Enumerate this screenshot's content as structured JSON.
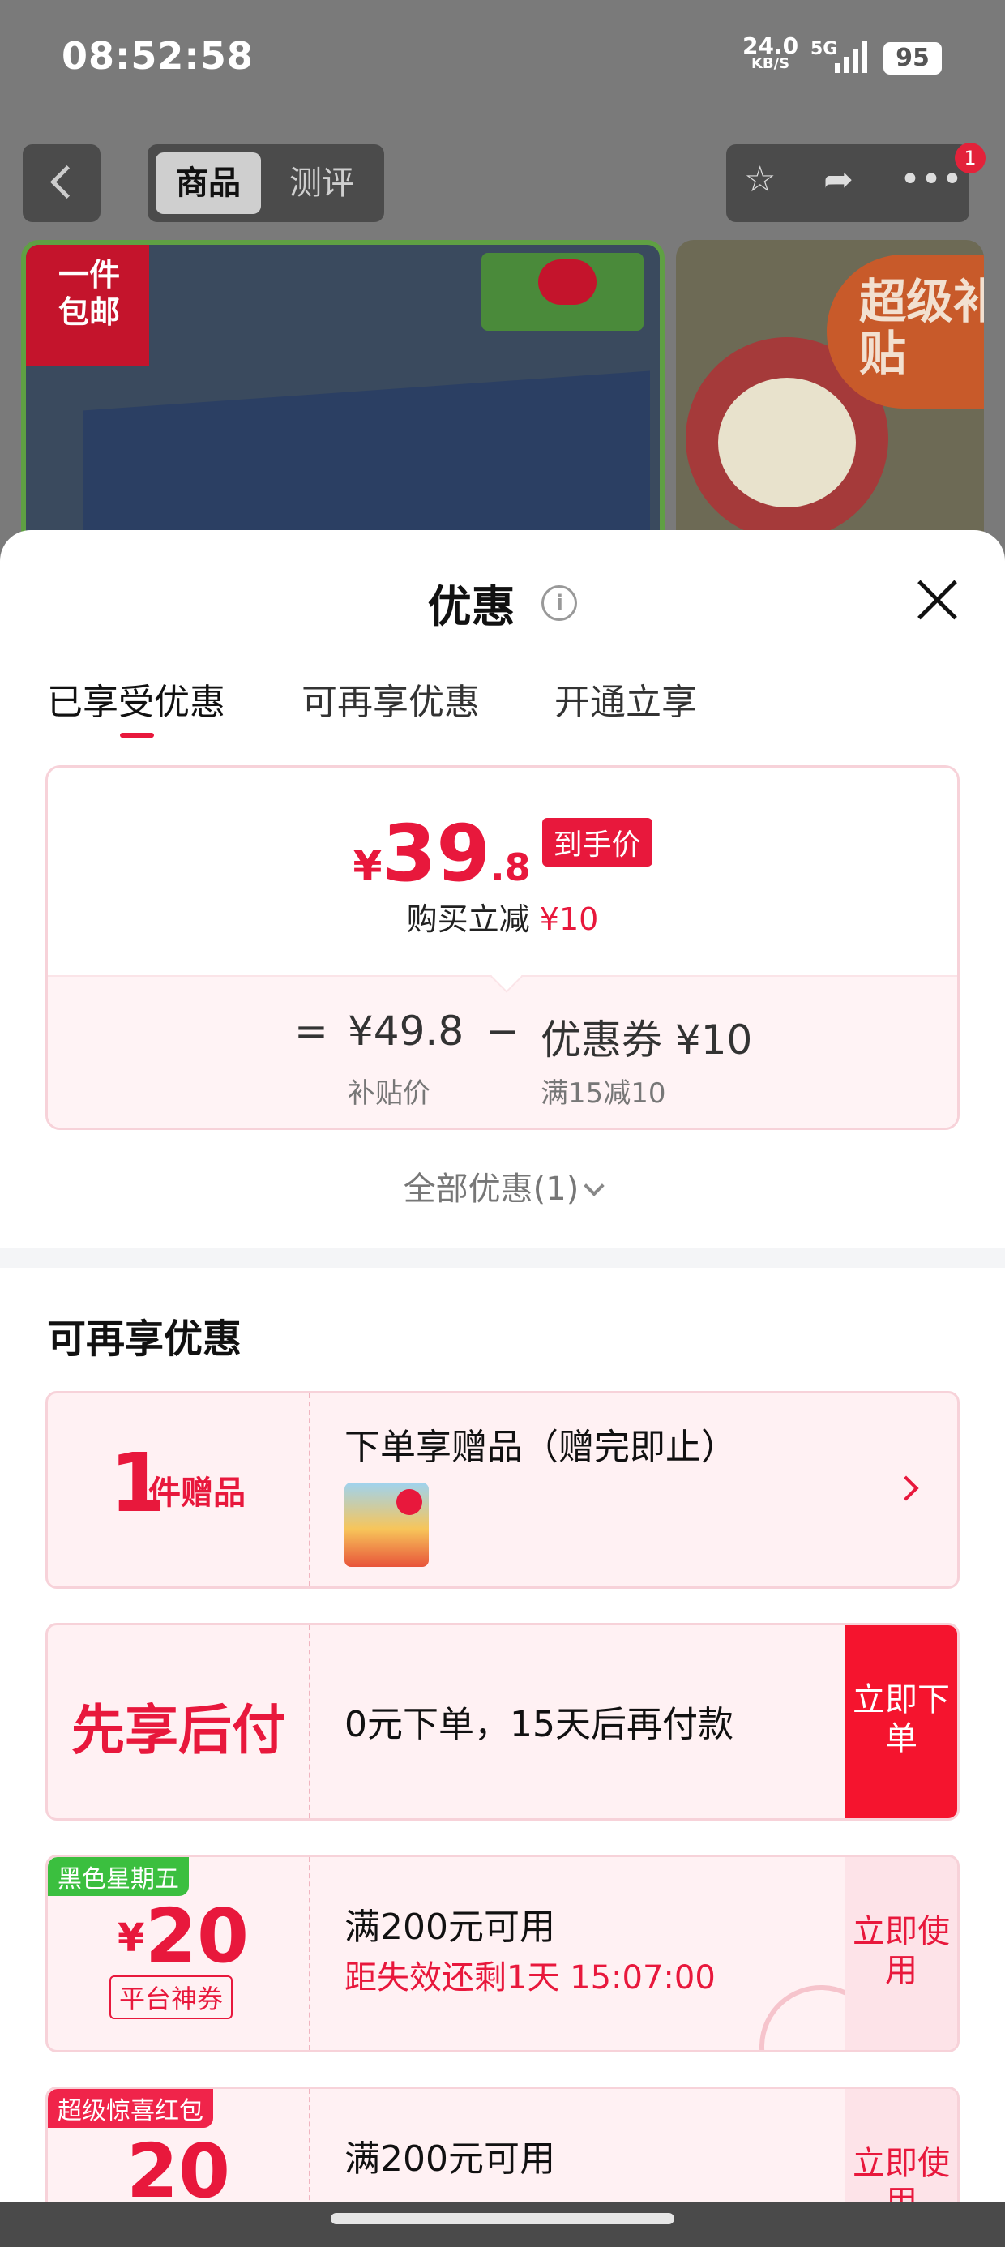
{
  "status_bar": {
    "time": "08:52:58",
    "net_speed": "24.0",
    "net_unit": "KB/S",
    "signal": "5G",
    "battery": "95"
  },
  "nav": {
    "tabs": [
      "商品",
      "测评"
    ],
    "badge_count": "1"
  },
  "product_banner": {
    "ribbon_text": "一件包邮",
    "super_tag": "超级补贴"
  },
  "sheet": {
    "title": "优惠",
    "close_icon": "close-icon",
    "tabs": [
      "已享受优惠",
      "可再享优惠",
      "开通立享"
    ],
    "active_tab": 0,
    "price": {
      "currency": "¥",
      "integer": "39",
      "decimal": ".8",
      "tag": "到手价",
      "subtitle_prefix": "购买立减",
      "subtitle_amount": "¥10"
    },
    "formula": {
      "equals": "=",
      "base_price": "¥49.8",
      "base_label": "补贴价",
      "minus": "−",
      "coupon_price": "优惠券 ¥10",
      "coupon_label": "满15减10"
    },
    "all_discounts": "全部优惠(1)"
  },
  "more_discounts": {
    "title": "可再享优惠",
    "items": [
      {
        "left_number": "1",
        "left_unit": "件赠品",
        "text": "下单享赠品（赠完即止）"
      },
      {
        "left_text": "先享后付",
        "text": "0元下单，15天后再付款",
        "button": "立即下单"
      },
      {
        "tag": "黑色星期五",
        "tag_color": "#3bbf3f",
        "currency": "¥",
        "amount": "20",
        "type_label": "平台神券",
        "text": "满200元可用",
        "subtext": "距失效还剩1天 15:07:00",
        "button": "立即使用"
      },
      {
        "tag": "超级惊喜红包",
        "tag_color": "#f0244a",
        "amount": "20",
        "text": "满200元可用",
        "button": "立即使用"
      }
    ]
  },
  "colors": {
    "accent": "#e8183c",
    "button_red": "#f5142e",
    "soft_pink": "#fff1f3"
  }
}
